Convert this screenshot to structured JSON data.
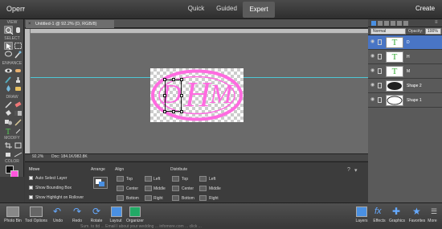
{
  "topbar": {
    "open_label": "Open",
    "modes": {
      "quick": "Quick",
      "guided": "Guided",
      "expert": "Expert"
    },
    "create_label": "Create"
  },
  "toolbox": {
    "sections": {
      "view": "VIEW",
      "select": "SELECT",
      "enhance": "ENHANCE",
      "draw": "DRAW",
      "modify": "MODIFY",
      "color": "COLOR"
    }
  },
  "document": {
    "tab_label": "Untitled-1 @ 92.2% (D, RGB/8)",
    "zoom": "92.2%",
    "doc_size": "Doc: 184.1K/982.8K",
    "monogram": {
      "left": "D",
      "middle": "H",
      "right": "M"
    }
  },
  "tool_options": {
    "move_title": "Move",
    "checkboxes": [
      "Auto Select Layer",
      "Show Bounding Box",
      "Show Highlight on Rollover"
    ],
    "arrange_label": "Arrange",
    "align_label": "Align",
    "align_items": [
      "Top",
      "Left",
      "Center",
      "Middle",
      "Bottom",
      "Right"
    ],
    "distribute_label": "Distribute",
    "distribute_items": [
      "Top",
      "Left",
      "Center",
      "Middle",
      "Bottom",
      "Right"
    ]
  },
  "layers_panel": {
    "blend_mode": "Normal",
    "opacity_label": "Opacity:",
    "opacity_value": "100%",
    "layers": [
      {
        "name": "D",
        "thumb": "T"
      },
      {
        "name": "H",
        "thumb": "T"
      },
      {
        "name": "M",
        "thumb": "T"
      },
      {
        "name": "Shape 2",
        "thumb": ""
      },
      {
        "name": "Shape 1",
        "thumb": ""
      }
    ]
  },
  "bottom_bar": {
    "left": [
      "Photo Bin",
      "Tool Options",
      "Undo",
      "Redo",
      "Rotate",
      "Layout",
      "Organizer"
    ],
    "right": [
      "Layers",
      "Effects",
      "Graphics",
      "Favorites",
      "More"
    ]
  },
  "taskbar_text": "Sum. to ttd ... Email I about your wedding ... infomore.com ... click ..."
}
